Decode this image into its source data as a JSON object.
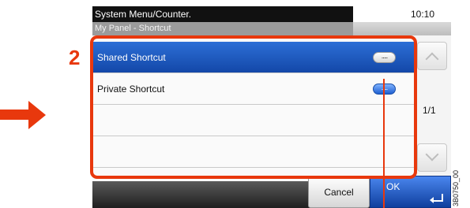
{
  "annotation": {
    "step_number": "2",
    "image_code": "3B0750_00",
    "accent_color": "#e8380d"
  },
  "header": {
    "title": "System Menu/Counter.",
    "time": "10:10",
    "subtitle": "My Panel - Shortcut"
  },
  "list": {
    "items": [
      {
        "label": "Shared Shortcut",
        "selected": true,
        "button_label": "....."
      },
      {
        "label": "Private Shortcut",
        "selected": false,
        "button_label": "....."
      },
      {
        "label": "",
        "selected": false
      },
      {
        "label": "",
        "selected": false
      }
    ],
    "page_indicator": "1/1"
  },
  "footer": {
    "cancel_label": "Cancel",
    "ok_label": "OK"
  },
  "icons": {
    "scroll_up": "chevron-up-icon",
    "scroll_down": "chevron-down-icon",
    "enter": "enter-icon",
    "pointer": "arrow-right-icon"
  }
}
